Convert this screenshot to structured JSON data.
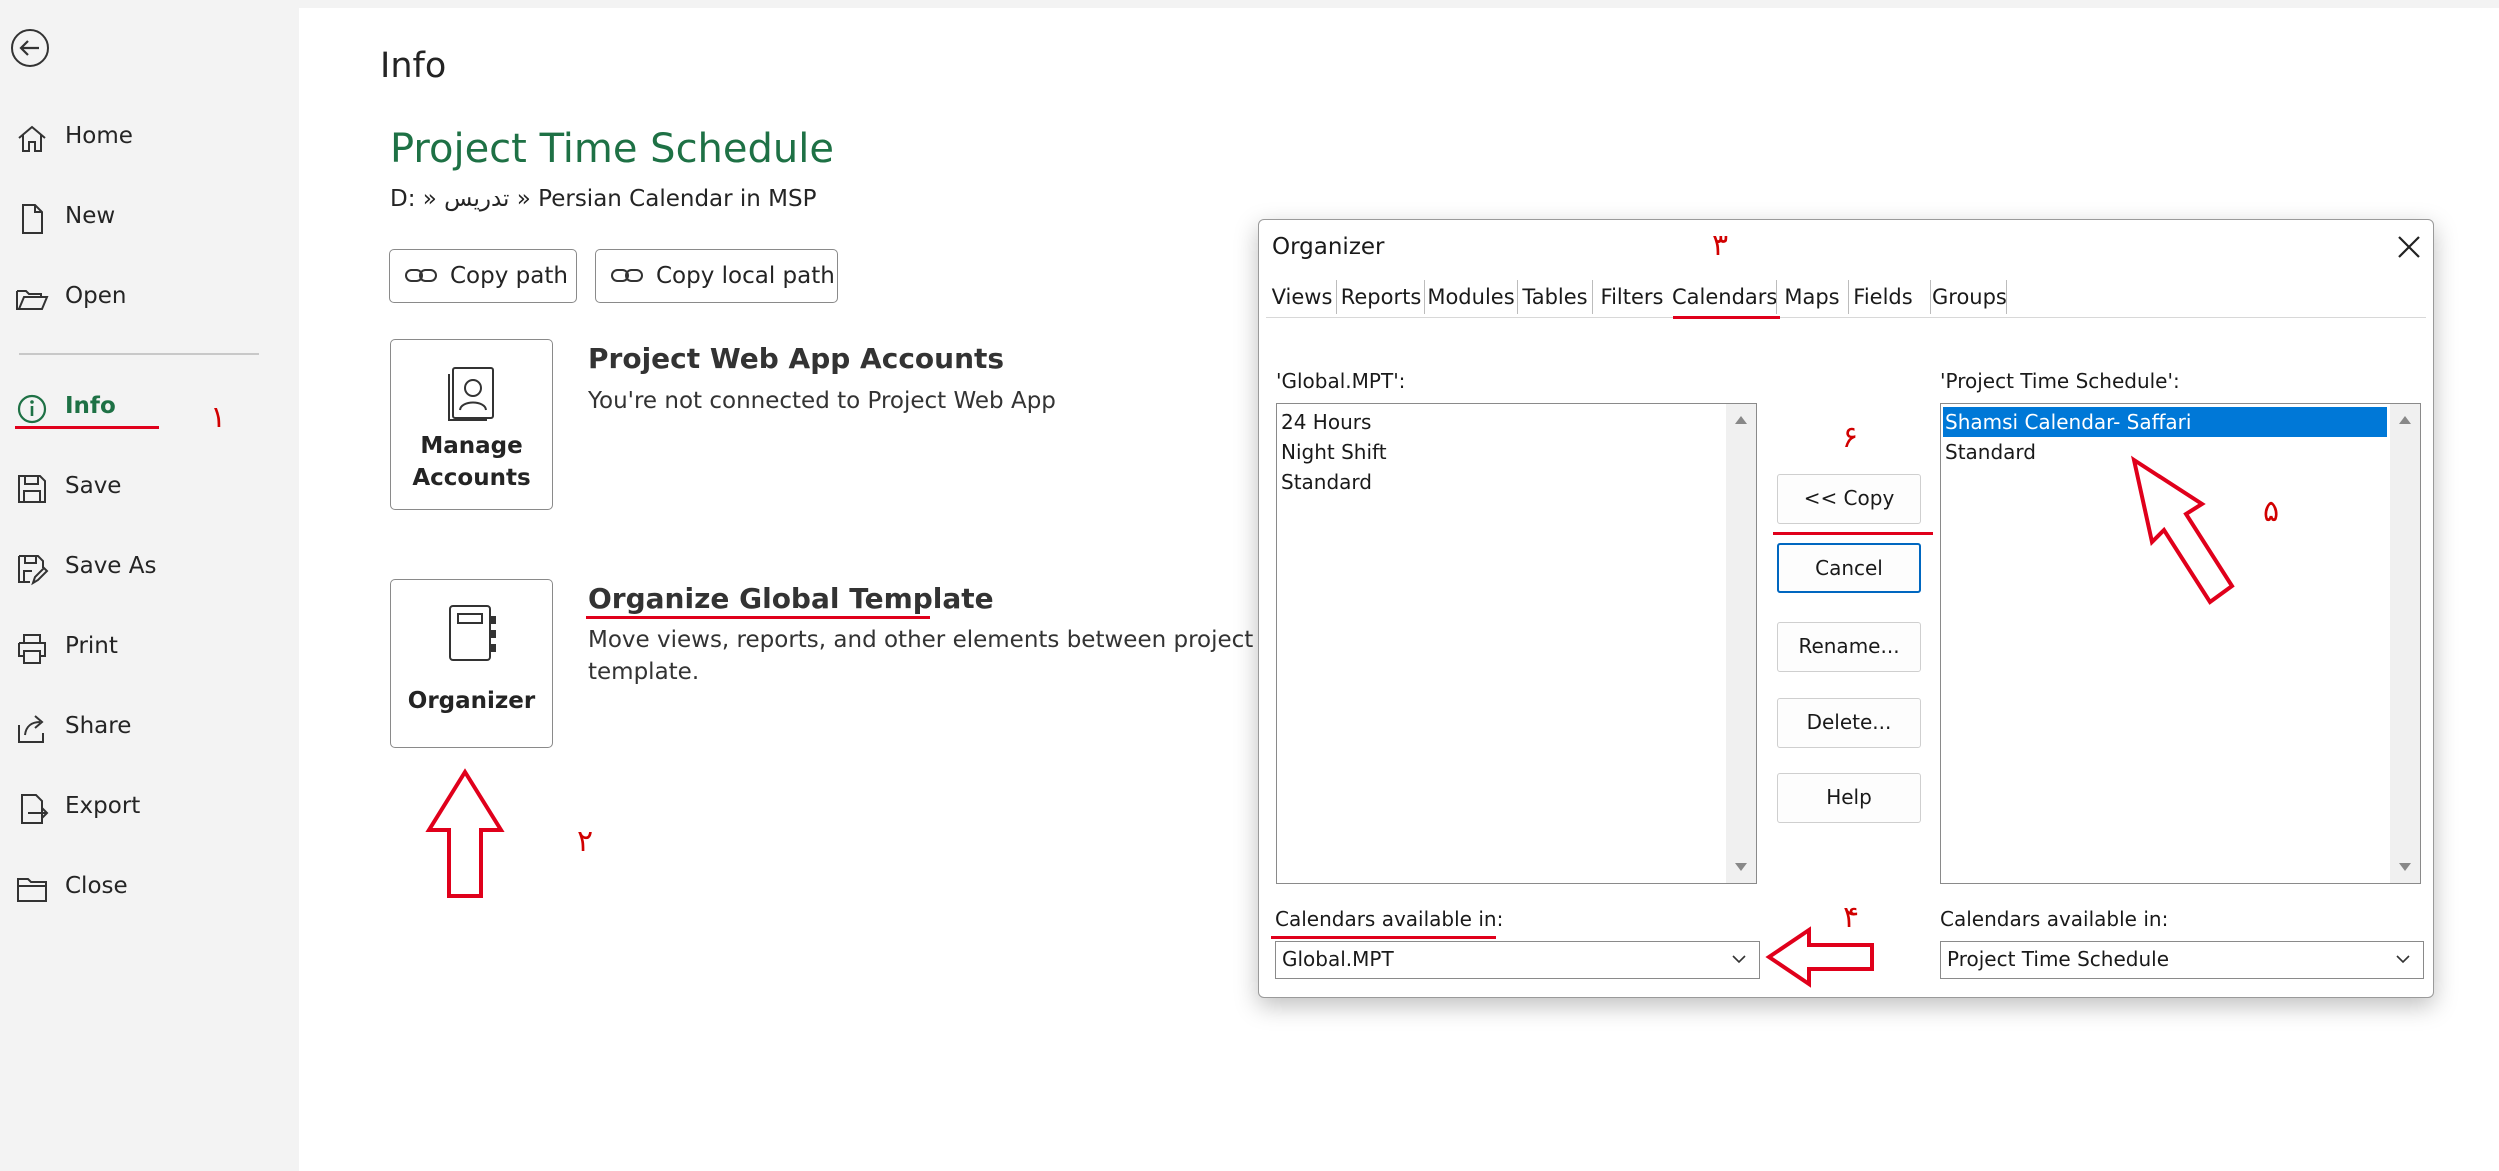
{
  "sidebar": {
    "items": [
      {
        "label": "Home",
        "icon": "home-icon"
      },
      {
        "label": "New",
        "icon": "new-file-icon"
      },
      {
        "label": "Open",
        "icon": "folder-open-icon"
      },
      {
        "label": "Info",
        "icon": "info-icon"
      },
      {
        "label": "Save",
        "icon": "save-icon"
      },
      {
        "label": "Save As",
        "icon": "save-as-icon"
      },
      {
        "label": "Print",
        "icon": "print-icon"
      },
      {
        "label": "Share",
        "icon": "share-icon"
      },
      {
        "label": "Export",
        "icon": "export-icon"
      },
      {
        "label": "Close",
        "icon": "close-folder-icon"
      }
    ]
  },
  "info": {
    "title": "Info",
    "project_title": "Project Time Schedule",
    "path": "D: » تدریس » Persian Calendar in MSP",
    "copy_path": "Copy path",
    "copy_local_path": "Copy local path",
    "pwa": {
      "tile_label": "Manage Accounts",
      "title": "Project Web App Accounts",
      "desc": "You're not connected to Project Web App"
    },
    "organizer": {
      "tile_label": "Organizer",
      "title": "Organize Global Template",
      "desc_line1": "Move views, reports, and other elements between project files",
      "desc_line2": "template."
    }
  },
  "dialog": {
    "title": "Organizer",
    "tabs": [
      "Views",
      "Reports",
      "Modules",
      "Tables",
      "Filters",
      "Calendars",
      "Maps",
      "Fields",
      "Groups"
    ],
    "active_tab": "Calendars",
    "left_label": "'Global.MPT':",
    "left_items": [
      "24 Hours",
      "Night Shift",
      "Standard"
    ],
    "right_label": "'Project Time Schedule':",
    "right_items": [
      "Shamsi Calendar- Saffari",
      "Standard"
    ],
    "right_selected": "Shamsi Calendar- Saffari",
    "buttons": {
      "copy": "<< Copy",
      "cancel": "Cancel",
      "rename": "Rename...",
      "delete": "Delete...",
      "help": "Help"
    },
    "left_available_label": "Calendars available in:",
    "left_available_value": "Global.MPT",
    "right_available_label": "Calendars available in:",
    "right_available_value": "Project Time Schedule"
  },
  "annotations": {
    "n1": "۱",
    "n2": "۲",
    "n3": "۳",
    "n4": "۴",
    "n5": "۵",
    "n6": "۶"
  },
  "colors": {
    "accent_green": "#1e7145",
    "annotation_red": "#e0001b",
    "selection_blue": "#0078d7"
  }
}
